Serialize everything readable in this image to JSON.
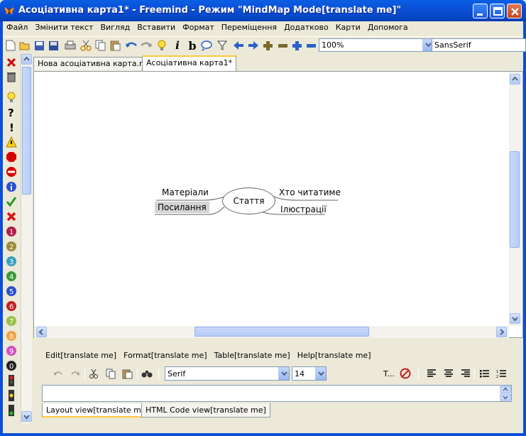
{
  "window": {
    "title": "Асоціативна карта1* - Freemind - Режим \"MindMap Mode[translate me]\""
  },
  "menu": [
    "Файл",
    "Змінити текст",
    "Вигляд",
    "Вставити",
    "Формат",
    "Переміщення",
    "Додатково",
    "Карти",
    "Допомога"
  ],
  "toolbar": {
    "zoom_value": "100%",
    "font_value": "SansSerif"
  },
  "tabs": [
    {
      "label": "Нова асоціативна карта.mm",
      "active": false
    },
    {
      "label": "Асоціативна карта1*",
      "active": true
    }
  ],
  "map": {
    "root": "Стаття",
    "left_nodes": [
      "Матеріали",
      "Посилання"
    ],
    "right_nodes": [
      "Хто читатиме",
      "Ілюстрації"
    ],
    "selected": "Посилання"
  },
  "editor": {
    "menu": [
      "Edit[translate me]",
      "Format[translate me]",
      "Table[translate me]",
      "Help[translate me]"
    ],
    "font_value": "Serif",
    "size_value": "14",
    "text_tool_label": "T...",
    "tabs": [
      {
        "label": "Layout view[translate me]",
        "active": true
      },
      {
        "label": "HTML Code view[translate me]",
        "active": false
      }
    ]
  },
  "colors": {
    "titlebar": "#0a4fd6",
    "selection": "#d4d4d4",
    "tab_accent": "#ffc83c"
  }
}
